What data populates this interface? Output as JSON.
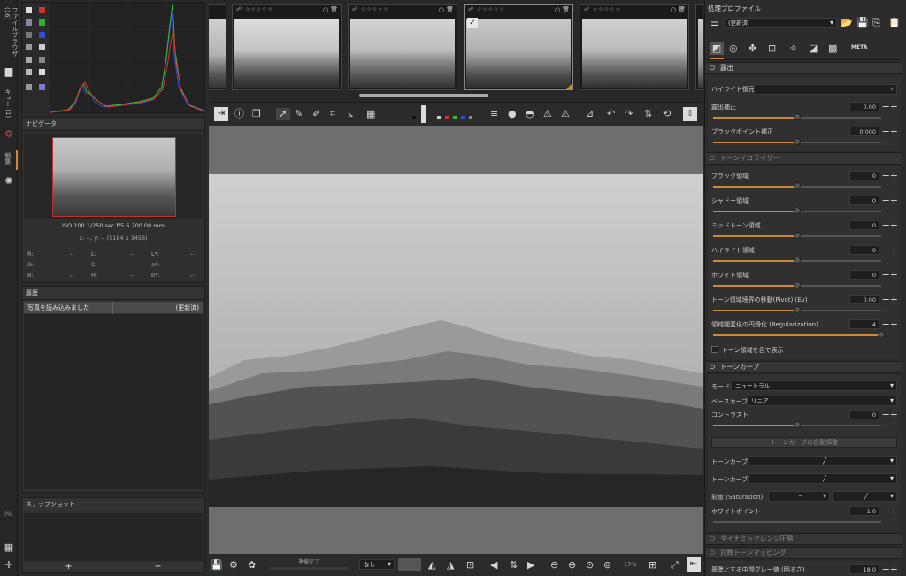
{
  "left_strip": {
    "tab_filebrowser": "ファイルブラウザ (16)",
    "tab_queue": "キュー (1)",
    "tab_editor": "編集",
    "zoom_small": "0%"
  },
  "navigator": {
    "title": "ナビゲータ",
    "exif": "ISO 100   1/250 sec   f/5.6   200.00 mm",
    "coords": "x: --, y: --   (5184 x 3456)",
    "info_rows": [
      [
        "R:",
        "--",
        "L:",
        "--",
        "L*:",
        "--"
      ],
      [
        "G:",
        "--",
        "C:",
        "--",
        "a*:",
        "--"
      ],
      [
        "B:",
        "--",
        "H:",
        "--",
        "b*:",
        "--"
      ]
    ]
  },
  "history": {
    "title": "履歴",
    "rows": [
      {
        "action": "写真を読み込みました",
        "value": "(更新済)"
      }
    ]
  },
  "snapshot": {
    "title": "スナップショット",
    "add": "+",
    "remove": "−"
  },
  "bottom_bar": {
    "status": "準備完了",
    "preset": "なし",
    "zoom": "17%"
  },
  "right_panel": {
    "profile_title": "処理プロファイル",
    "profile_value": "(更新済)",
    "exposure": {
      "title": "露出",
      "highlight_label": "ハイライト復元",
      "exposure_label": "露出補正",
      "exposure_value": "0.00",
      "exposure_frac": 0.5,
      "black_label": "ブラックポイント補正",
      "black_value": "0.000",
      "black_frac": 0.5
    },
    "tone_eq": {
      "title": "トーンイコライザー",
      "rows": [
        {
          "label": "ブラック領域",
          "value": "0",
          "frac": 0.5
        },
        {
          "label": "シャドー領域",
          "value": "0",
          "frac": 0.5
        },
        {
          "label": "ミッドトーン領域",
          "value": "0",
          "frac": 0.5
        },
        {
          "label": "ハイライト領域",
          "value": "0",
          "frac": 0.5
        },
        {
          "label": "ホワイト領域",
          "value": "0",
          "frac": 0.5
        },
        {
          "label": "トーン領域境界の移動(Pivot) (Ev)",
          "value": "0.00",
          "frac": 0.5
        },
        {
          "label": "領域閾変化の円滑化 (Regularization)",
          "value": "4",
          "frac": 1.0
        }
      ],
      "show_colors": "トーン領域を色で表示"
    },
    "tone_curve": {
      "title": "トーンカーブ",
      "mode_label": "モード:",
      "mode_value": "ニュートラル",
      "base_label": "ベースカーブ:",
      "base_value": "リニア",
      "contrast_label": "コントラスト",
      "contrast_value": "0",
      "contrast_frac": 0.5,
      "auto_button": "トーンカーブの自動調整",
      "curve1": "トーンカーブ1:",
      "curve2": "トーンカーブ2:",
      "saturation_label": "彩度 (Saturation):",
      "white_label": "ホワイトポイント",
      "white_value": "1.0"
    },
    "dynamic_range": {
      "title": "ダイナミックレンジ圧縮"
    },
    "log_tone": {
      "title": "対数トーンマッピング",
      "gray_label": "基準とする中間グレー値 (明るさ)",
      "gray_value": "18.0"
    }
  }
}
